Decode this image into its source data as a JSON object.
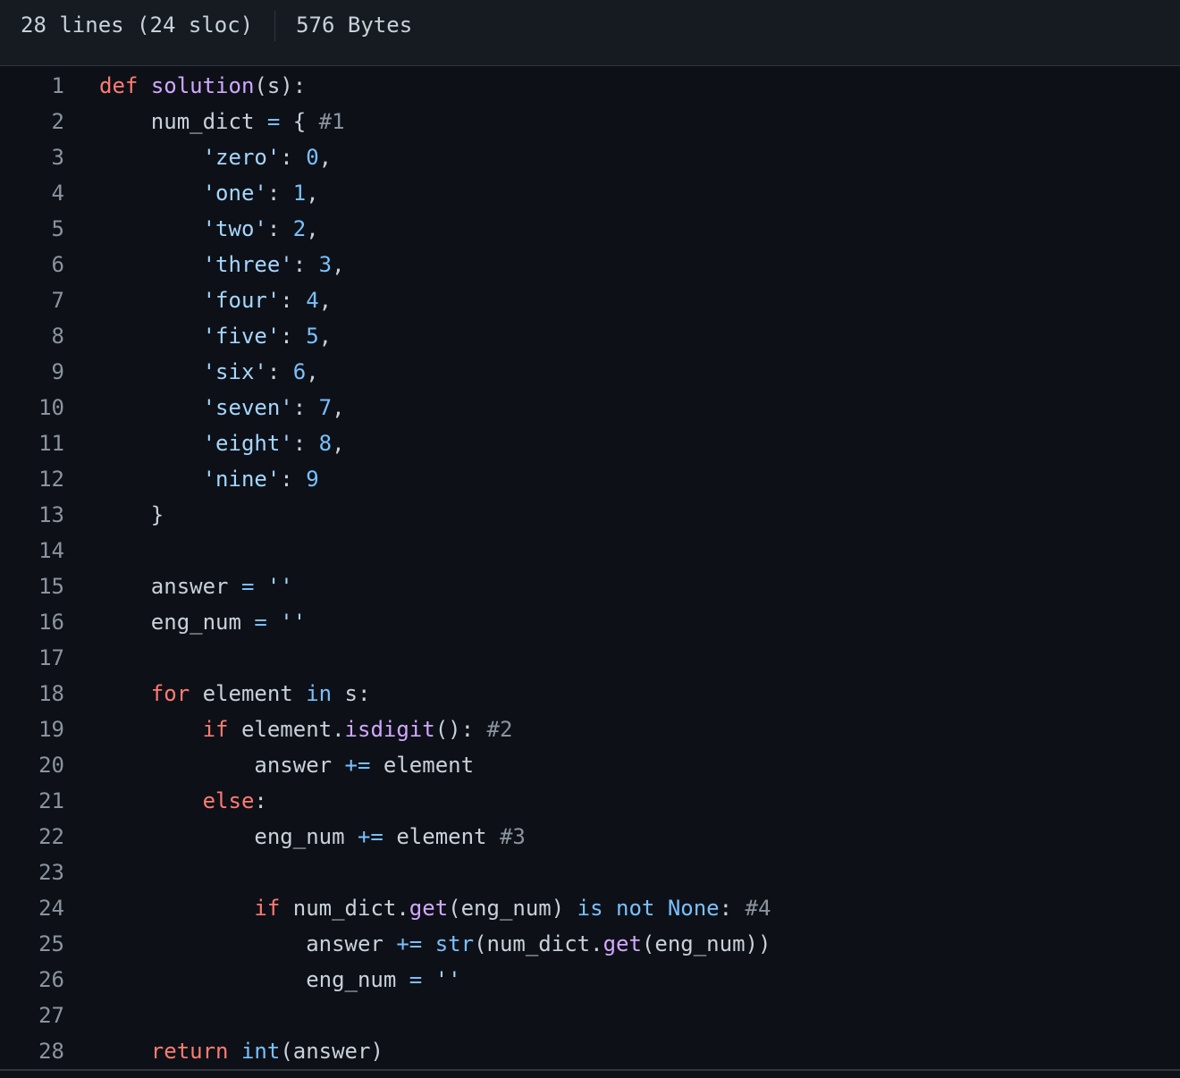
{
  "file_info": {
    "lines_label": "28 lines (24 sloc)",
    "size_label": "576 Bytes"
  },
  "code_lines": [
    [
      [
        "kw",
        "def"
      ],
      [
        "txt",
        " "
      ],
      [
        "fn",
        "solution"
      ],
      [
        "txt",
        "(s):"
      ]
    ],
    [
      [
        "txt",
        "    num_dict "
      ],
      [
        "op",
        "="
      ],
      [
        "txt",
        " { "
      ],
      [
        "cmt",
        "#1"
      ]
    ],
    [
      [
        "txt",
        "        "
      ],
      [
        "str",
        "'zero'"
      ],
      [
        "txt",
        ": "
      ],
      [
        "num",
        "0"
      ],
      [
        "txt",
        ","
      ]
    ],
    [
      [
        "txt",
        "        "
      ],
      [
        "str",
        "'one'"
      ],
      [
        "txt",
        ": "
      ],
      [
        "num",
        "1"
      ],
      [
        "txt",
        ","
      ]
    ],
    [
      [
        "txt",
        "        "
      ],
      [
        "str",
        "'two'"
      ],
      [
        "txt",
        ": "
      ],
      [
        "num",
        "2"
      ],
      [
        "txt",
        ","
      ]
    ],
    [
      [
        "txt",
        "        "
      ],
      [
        "str",
        "'three'"
      ],
      [
        "txt",
        ": "
      ],
      [
        "num",
        "3"
      ],
      [
        "txt",
        ","
      ]
    ],
    [
      [
        "txt",
        "        "
      ],
      [
        "str",
        "'four'"
      ],
      [
        "txt",
        ": "
      ],
      [
        "num",
        "4"
      ],
      [
        "txt",
        ","
      ]
    ],
    [
      [
        "txt",
        "        "
      ],
      [
        "str",
        "'five'"
      ],
      [
        "txt",
        ": "
      ],
      [
        "num",
        "5"
      ],
      [
        "txt",
        ","
      ]
    ],
    [
      [
        "txt",
        "        "
      ],
      [
        "str",
        "'six'"
      ],
      [
        "txt",
        ": "
      ],
      [
        "num",
        "6"
      ],
      [
        "txt",
        ","
      ]
    ],
    [
      [
        "txt",
        "        "
      ],
      [
        "str",
        "'seven'"
      ],
      [
        "txt",
        ": "
      ],
      [
        "num",
        "7"
      ],
      [
        "txt",
        ","
      ]
    ],
    [
      [
        "txt",
        "        "
      ],
      [
        "str",
        "'eight'"
      ],
      [
        "txt",
        ": "
      ],
      [
        "num",
        "8"
      ],
      [
        "txt",
        ","
      ]
    ],
    [
      [
        "txt",
        "        "
      ],
      [
        "str",
        "'nine'"
      ],
      [
        "txt",
        ": "
      ],
      [
        "num",
        "9"
      ]
    ],
    [
      [
        "txt",
        "    }"
      ]
    ],
    [],
    [
      [
        "txt",
        "    answer "
      ],
      [
        "op",
        "="
      ],
      [
        "txt",
        " "
      ],
      [
        "str",
        "''"
      ]
    ],
    [
      [
        "txt",
        "    eng_num "
      ],
      [
        "op",
        "="
      ],
      [
        "txt",
        " "
      ],
      [
        "str",
        "''"
      ]
    ],
    [],
    [
      [
        "txt",
        "    "
      ],
      [
        "kw",
        "for"
      ],
      [
        "txt",
        " element "
      ],
      [
        "op",
        "in"
      ],
      [
        "txt",
        " s:"
      ]
    ],
    [
      [
        "txt",
        "        "
      ],
      [
        "kw",
        "if"
      ],
      [
        "txt",
        " element."
      ],
      [
        "fn",
        "isdigit"
      ],
      [
        "txt",
        "(): "
      ],
      [
        "cmt",
        "#2"
      ]
    ],
    [
      [
        "txt",
        "            answer "
      ],
      [
        "op",
        "+="
      ],
      [
        "txt",
        " element"
      ]
    ],
    [
      [
        "txt",
        "        "
      ],
      [
        "kw",
        "else"
      ],
      [
        "txt",
        ":"
      ]
    ],
    [
      [
        "txt",
        "            eng_num "
      ],
      [
        "op",
        "+="
      ],
      [
        "txt",
        " element "
      ],
      [
        "cmt",
        "#3"
      ]
    ],
    [],
    [
      [
        "txt",
        "            "
      ],
      [
        "kw",
        "if"
      ],
      [
        "txt",
        " num_dict."
      ],
      [
        "fn",
        "get"
      ],
      [
        "txt",
        "(eng_num) "
      ],
      [
        "op",
        "is not"
      ],
      [
        "txt",
        " "
      ],
      [
        "bi",
        "None"
      ],
      [
        "txt",
        ": "
      ],
      [
        "cmt",
        "#4"
      ]
    ],
    [
      [
        "txt",
        "                answer "
      ],
      [
        "op",
        "+="
      ],
      [
        "txt",
        " "
      ],
      [
        "bi",
        "str"
      ],
      [
        "txt",
        "(num_dict."
      ],
      [
        "fn",
        "get"
      ],
      [
        "txt",
        "(eng_num))"
      ]
    ],
    [
      [
        "txt",
        "                eng_num "
      ],
      [
        "op",
        "="
      ],
      [
        "txt",
        " "
      ],
      [
        "str",
        "''"
      ]
    ],
    [],
    [
      [
        "txt",
        "    "
      ],
      [
        "kw",
        "return"
      ],
      [
        "txt",
        " "
      ],
      [
        "bi",
        "int"
      ],
      [
        "txt",
        "(answer)"
      ]
    ]
  ]
}
